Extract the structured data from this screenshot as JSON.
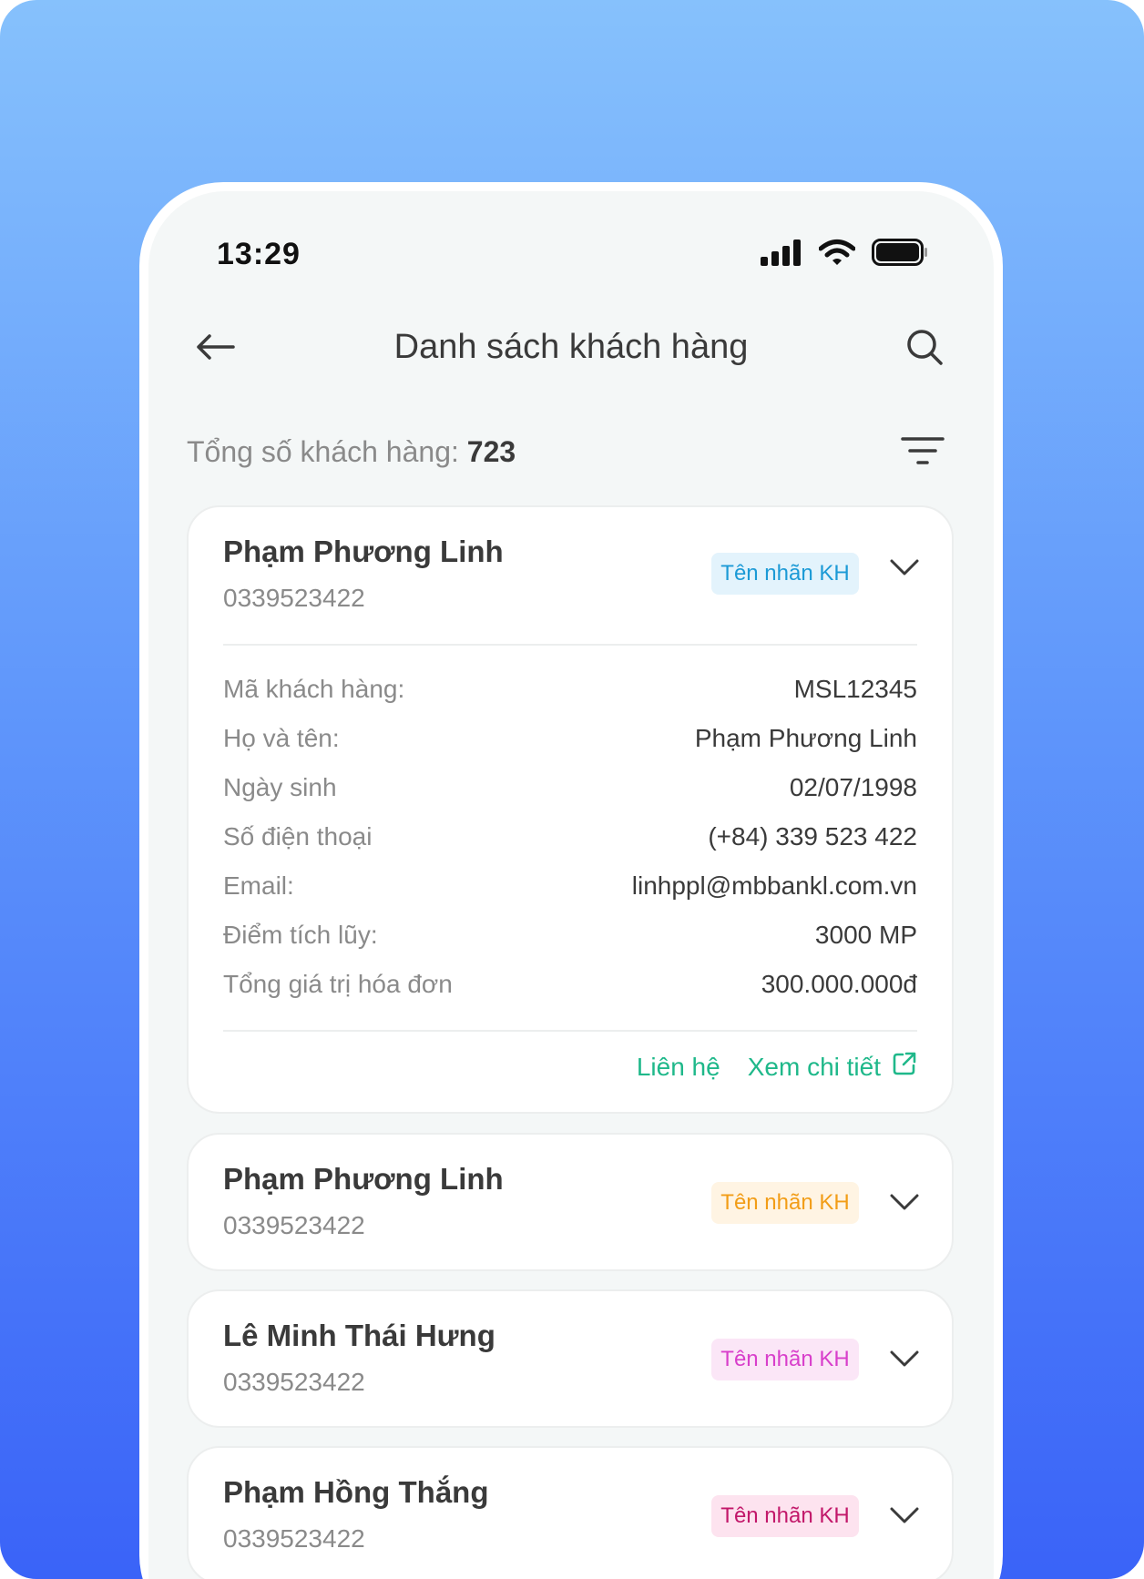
{
  "status_bar": {
    "time": "13:29"
  },
  "header": {
    "title": "Danh sách khách hàng"
  },
  "summary": {
    "label": "Tổng số khách hàng:",
    "count": "723"
  },
  "customers": [
    {
      "name": "Phạm Phương Linh",
      "phone": "0339523422",
      "tag": "Tên nhãn KH",
      "tag_bg": "#e3f3fc",
      "tag_color": "#1c9ad6",
      "expanded": true,
      "details": [
        {
          "label": "Mã khách hàng:",
          "value": "MSL12345"
        },
        {
          "label": "Họ và tên:",
          "value": "Phạm Phương Linh"
        },
        {
          "label": "Ngày sinh",
          "value": "02/07/1998"
        },
        {
          "label": "Số điện thoại",
          "value": "(+84) 339 523 422"
        },
        {
          "label": "Email:",
          "value": "linhppl@mbbankl.com.vn"
        },
        {
          "label": "Điểm tích lũy:",
          "value": "3000 MP"
        },
        {
          "label": "Tổng giá trị hóa đơn",
          "value": "300.000.000đ"
        }
      ],
      "actions": {
        "contact": "Liên hệ",
        "view_detail": "Xem chi tiết"
      }
    },
    {
      "name": "Phạm Phương Linh",
      "phone": "0339523422",
      "tag": "Tên nhãn KH",
      "tag_bg": "#fff4e3",
      "tag_color": "#f29d17"
    },
    {
      "name": "Lê Minh Thái Hưng",
      "phone": "0339523422",
      "tag": "Tên nhãn KH",
      "tag_bg": "#fbe6f7",
      "tag_color": "#d83fcb"
    },
    {
      "name": "Phạm Hồng Thắng",
      "phone": "0339523422",
      "tag": "Tên nhãn KH",
      "tag_bg": "#fde3ef",
      "tag_color": "#c2186a"
    }
  ],
  "colors": {
    "accent_green": "#1fb88a",
    "bg_gradient_top": "#86c1fc",
    "bg_gradient_bottom": "#3a63f8"
  },
  "icons": [
    "back-arrow-icon",
    "search-icon",
    "filter-icon",
    "chevron-down-icon",
    "external-link-icon",
    "signal-icon",
    "wifi-icon",
    "battery-icon"
  ]
}
